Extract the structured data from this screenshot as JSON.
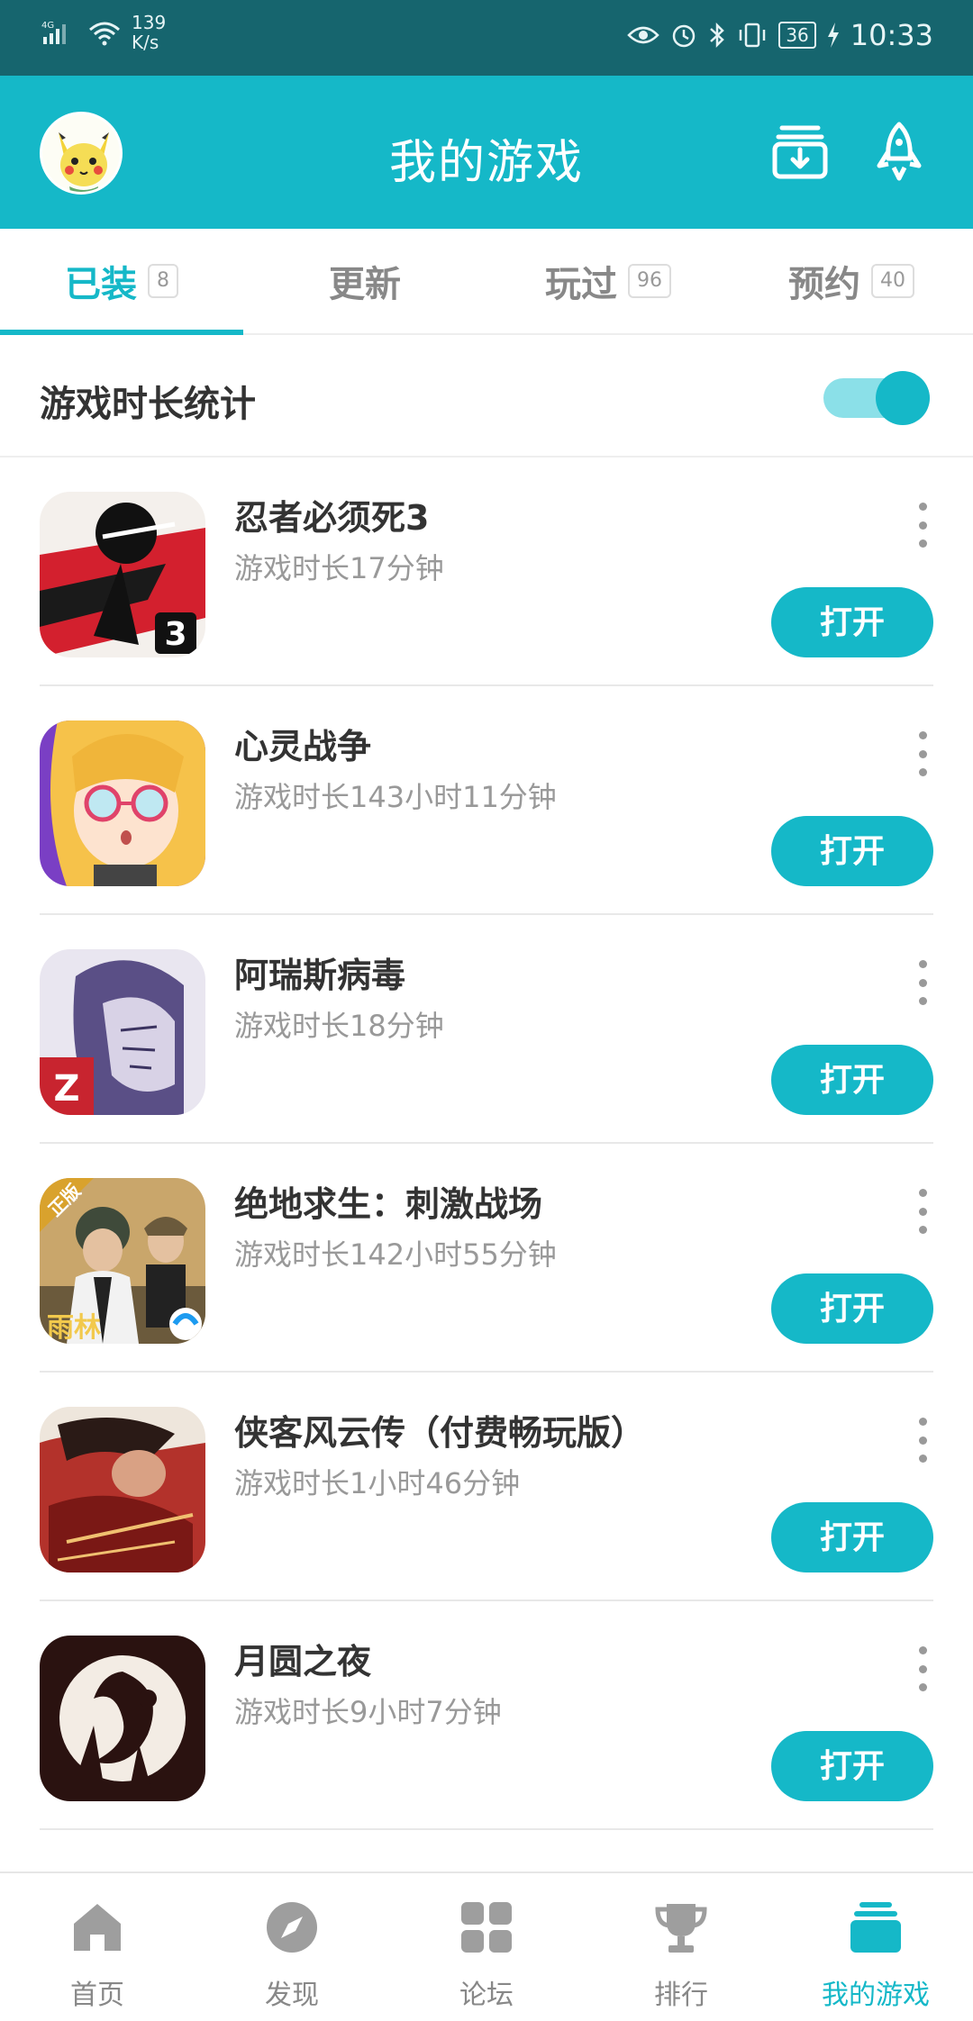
{
  "status_bar": {
    "network": "4G",
    "speed_value": "139",
    "speed_unit": "K/s",
    "battery": "36",
    "time": "10:33"
  },
  "header": {
    "title": "我的游戏"
  },
  "tabs": [
    {
      "label": "已装",
      "badge": "8"
    },
    {
      "label": "更新",
      "badge": ""
    },
    {
      "label": "玩过",
      "badge": "96"
    },
    {
      "label": "预约",
      "badge": "40"
    }
  ],
  "stats": {
    "label": "游戏时长统计",
    "enabled": true
  },
  "games": [
    {
      "title": "忍者必须死3",
      "time": "游戏时长17分钟",
      "action": "打开"
    },
    {
      "title": "心灵战争",
      "time": "游戏时长143小时11分钟",
      "action": "打开"
    },
    {
      "title": "阿瑞斯病毒",
      "time": "游戏时长18分钟",
      "action": "打开"
    },
    {
      "title": "绝地求生：刺激战场",
      "time": "游戏时长142小时55分钟",
      "action": "打开"
    },
    {
      "title": "侠客风云传（付费畅玩版）",
      "time": "游戏时长1小时46分钟",
      "action": "打开"
    },
    {
      "title": "月圆之夜",
      "time": "游戏时长9小时7分钟",
      "action": "打开"
    }
  ],
  "game_icons": {
    "ninja_badge": "3",
    "pubg_badge": "正版",
    "pubg_brand": "雨林"
  },
  "bottom_nav": [
    {
      "label": "首页",
      "icon": "home-icon"
    },
    {
      "label": "发现",
      "icon": "compass-icon"
    },
    {
      "label": "论坛",
      "icon": "grid-icon"
    },
    {
      "label": "排行",
      "icon": "trophy-icon"
    },
    {
      "label": "我的游戏",
      "icon": "my-games-icon"
    }
  ],
  "colors": {
    "accent": "#15b8c8",
    "status_bar": "#16656e"
  }
}
